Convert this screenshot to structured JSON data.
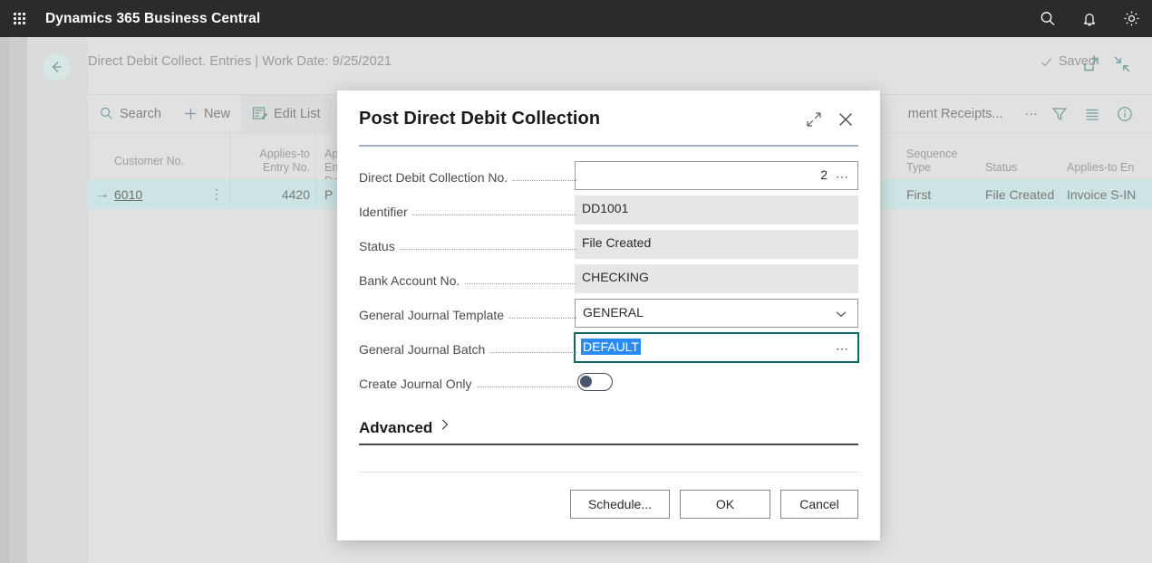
{
  "topbar": {
    "waffle_icon": "app-launcher-icon",
    "title": "Dynamics 365 Business Central",
    "icons": [
      {
        "name": "search-icon",
        "label": "Search"
      },
      {
        "name": "notification-bell-icon",
        "label": "Notifications"
      },
      {
        "name": "gear-icon",
        "label": "Settings"
      }
    ]
  },
  "page_header": {
    "back_icon": "back-arrow-icon",
    "breadcrumb": "Direct Debit Collect. Entries | Work Date: 9/25/2021",
    "saved_label": "Saved",
    "saved_icon": "checkmark-icon",
    "open_new_window_icon": "open-in-new-window-icon",
    "collapse_icon": "collapse-icon"
  },
  "toolbar": {
    "items": [
      {
        "name": "search",
        "label": "Search",
        "icon": "search-icon",
        "active": false
      },
      {
        "name": "new",
        "label": "New",
        "icon": "plus-icon",
        "active": false
      },
      {
        "name": "edit-list",
        "label": "Edit List",
        "icon": "edit-list-icon",
        "active": true
      },
      {
        "name": "delete",
        "label": "",
        "icon": "trash-icon",
        "active": false
      },
      {
        "name": "payment-receipts",
        "label": "ment Receipts...",
        "icon": "",
        "active": false
      },
      {
        "name": "more-options",
        "label": "···",
        "icon": "ellipsis-icon",
        "active": false
      }
    ],
    "right_icons": [
      {
        "name": "filter-icon",
        "label": "Filter"
      },
      {
        "name": "list-view-icon",
        "label": "List"
      },
      {
        "name": "info-icon",
        "label": "Info"
      }
    ]
  },
  "grid": {
    "columns": [
      {
        "name": "customer-no",
        "header": "Customer No."
      },
      {
        "name": "applies-to-entry-no",
        "header": "Applies-to\nEntry No."
      },
      {
        "name": "applies-to-entry-doc",
        "header_l1": "Ap",
        "header_l2": "En",
        "header_l3": "Do"
      },
      {
        "name": "sequence-type",
        "header_l1": "Sequence",
        "header_l2": "Type"
      },
      {
        "name": "status",
        "header": "Status"
      },
      {
        "name": "applies-to-entry",
        "header": "Applies-to En"
      }
    ],
    "row": {
      "row_arrow": "→",
      "customer_no": "6010",
      "row_menu": "⋮",
      "applies_to_entry_no": "4420",
      "applies_to_entry_doc": "P",
      "sequence_type": "First",
      "status": "File Created",
      "applies_to_entry": "Invoice S-IN"
    }
  },
  "dialog": {
    "title": "Post Direct Debit Collection",
    "expand_icon": "expand-icon",
    "close_icon": "close-icon",
    "fields": [
      {
        "name": "direct-debit-collection-no",
        "label": "Direct Debit Collection No.",
        "value": "2",
        "state": "editable",
        "align": "right",
        "control": "assist-edit",
        "assist_glyph": "⋯"
      },
      {
        "name": "identifier",
        "label": "Identifier",
        "value": "DD1001",
        "state": "readonly",
        "align": "left",
        "control": "text"
      },
      {
        "name": "status",
        "label": "Status",
        "value": "File Created",
        "state": "readonly",
        "align": "left",
        "control": "text"
      },
      {
        "name": "bank-account-no",
        "label": "Bank Account No.",
        "value": "CHECKING",
        "state": "readonly",
        "align": "left",
        "control": "text"
      },
      {
        "name": "general-journal-template",
        "label": "General Journal Template",
        "value": "GENERAL",
        "state": "editable",
        "align": "left",
        "control": "dropdown"
      },
      {
        "name": "general-journal-batch",
        "label": "General Journal Batch",
        "value": "DEFAULT",
        "state": "focused",
        "align": "left",
        "control": "assist-edit",
        "selected": true,
        "assist_glyph": "⋯"
      }
    ],
    "toggle_field": {
      "name": "create-journal-only",
      "label": "Create Journal Only",
      "value": "off"
    },
    "advanced": {
      "label": "Advanced",
      "chevron_icon": "chevron-right-icon"
    },
    "buttons": [
      {
        "name": "schedule-button",
        "label": "Schedule..."
      },
      {
        "name": "ok-button",
        "label": "OK"
      },
      {
        "name": "cancel-button",
        "label": "Cancel"
      }
    ]
  },
  "colors": {
    "topbar_bg": "#2b2b2b",
    "accent_teal": "#0b6a68",
    "row_highlight": "#b4d8d6",
    "selection_blue": "#2a8bf2",
    "page_bg": "#d3d3d3"
  }
}
